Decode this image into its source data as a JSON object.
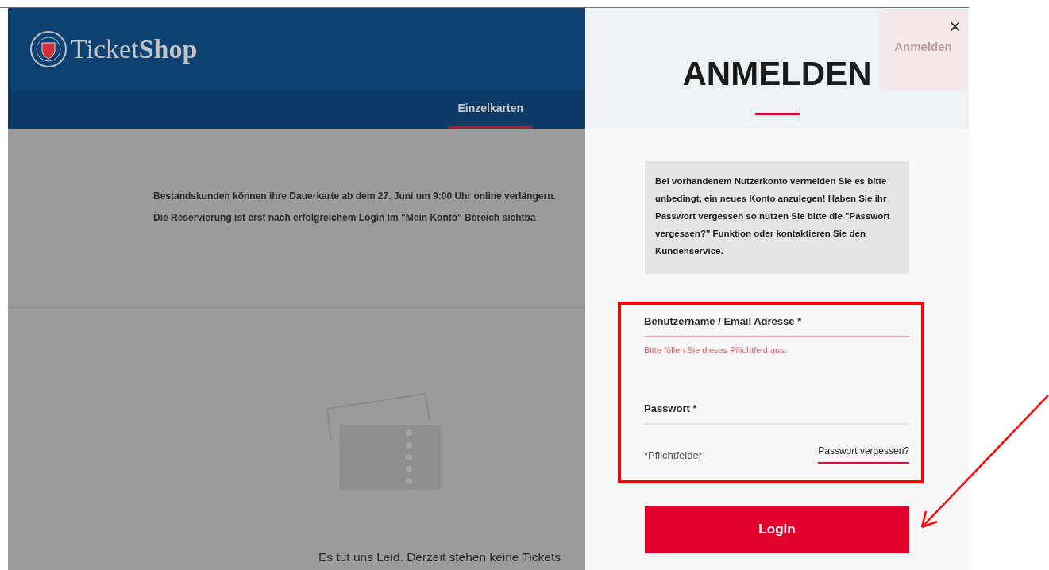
{
  "header": {
    "logo_text": "Ticket",
    "logo_text_bold": "Shop",
    "nav": [
      {
        "label": "Einzelkarten",
        "selected": true
      }
    ],
    "login_button": "Anmelden"
  },
  "notice": {
    "lines": [
      "Bestandskunden können ihre Dauerkarte ab dem 27. Juni um 9:00 Uhr online verlängern.",
      "Die Reservierung ist erst nach erfolgreichem Login im \"Mein Konto\" Bereich sichtba"
    ]
  },
  "empty_message": "Es tut uns Leid. Derzeit stehen keine Tickets",
  "login_panel": {
    "close": "×",
    "title": "ANMELDEN",
    "info": "Bei vorhandenem Nutzerkonto vermeiden Sie es bitte unbedingt, ein neues Konto anzulegen! Haben Sie ihr Passwort vergessen so nutzen Sie bitte die \"Passwort vergessen?\" Funktion oder kontaktieren Sie den Kundenservice.",
    "fields": [
      {
        "label": "Benutzername / Email Adresse *",
        "invalid": true,
        "error": "Bitte füllen Sie dieses Pflichtfeld aus."
      },
      {
        "label": "Passwort *",
        "invalid": false
      }
    ],
    "required_note": "*Pflichtfelder",
    "forgot_link": "Passwort vergessen?",
    "submit": "Login"
  }
}
